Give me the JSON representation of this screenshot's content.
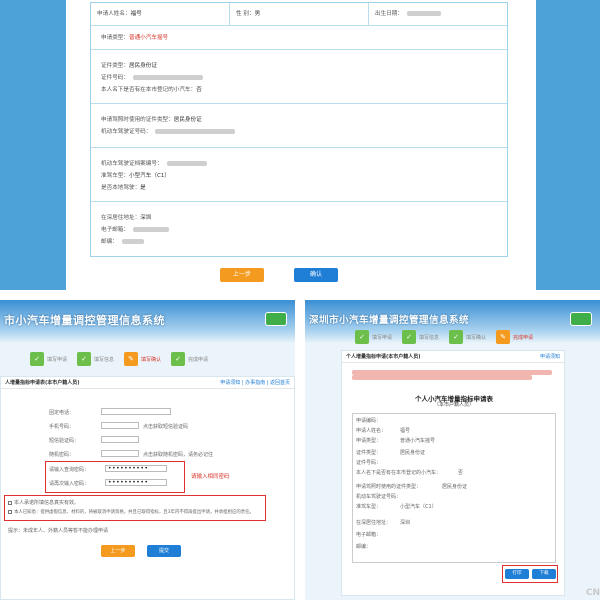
{
  "top": {
    "row1": {
      "name_label": "申请人姓名：",
      "name_value": "福号",
      "gender_label": "性 别：",
      "gender_value": "男",
      "birth_label": "出生日期："
    },
    "row2": {
      "type_label": "申请类型：",
      "type_value": "普通小汽车摇号"
    },
    "row3": {
      "id_type_label": "证件类型：",
      "id_type_value": "居民身份证",
      "id_no_label": "证件号码：",
      "owned_label": "本人名下是否有在本市登记的小汽车：",
      "owned_value": "否"
    },
    "row4": {
      "license_id_type_label": "申请驾照时使用的证件类型：",
      "license_id_type_value": "居民身份证",
      "license_no_label": "机动车驾驶证号码："
    },
    "row5": {
      "file_no_label": "机动车驾驶证档案编号：",
      "car_type_label": "准驾车型：",
      "car_type_value": "小型汽车（C1）",
      "local_label": "是否本地驾驶：",
      "local_value": "是"
    },
    "row6": {
      "address_label": "在深居住地址：",
      "address_value": "深圳",
      "email_label": "电子邮箱：",
      "postcode_label": "邮编："
    },
    "prev_button": "上一步",
    "confirm_button": "确认"
  },
  "bottom_left": {
    "banner_title": "市小汽车增量调控管理信息系统",
    "steps": [
      "填写申请",
      "填写信息",
      "填写确认",
      "完成申请"
    ],
    "section_title": "人增量指标申请表(本市户籍人员)",
    "section_links": "申请须知 | 办事指南 | 返回首页",
    "fields": [
      {
        "label": "固定电话：",
        "value": ""
      },
      {
        "label": "手机号码：",
        "value": ""
      },
      {
        "label": "短信验证码：",
        "value": ""
      },
      {
        "label": "随机密码：",
        "value": ""
      },
      {
        "label": "请输入查询密码：",
        "value": "••••••••••"
      },
      {
        "label": "请再次输入密码：",
        "value": "••••••••••"
      }
    ],
    "hint_phone": "点击获取短信验证码",
    "hint_random": "点击获取随机密码，请务必记住",
    "annotation": "请输入相同密码",
    "agree_1": "本人承诺所填信息真实有效。",
    "agree_2": "本人已知悉：提供虚假信息、材料的，将被取消申请资格，并且已取得指标，且3年内不得再提出申请，并承担相应的责任。",
    "footnote": "提示：未成年人、外籍人员等暂不能办理申请",
    "prev_button": "上一步",
    "submit_button": "提交"
  },
  "bottom_right": {
    "banner_title": "深圳市小汽车增量调控管理信息系统",
    "steps": [
      "填写申请",
      "填写信息",
      "填写确认",
      "完成申请"
    ],
    "doc_header_left": "个人增量指标申请(本市户籍人员)",
    "doc_header_right": "申请须知",
    "doc_title": "个人小汽车增量指标申请表",
    "doc_subtitle": "（本市户籍人员）",
    "fields": [
      {
        "label": "申请编码：",
        "value": ""
      },
      {
        "label": "申请人姓名：",
        "value": "福号"
      },
      {
        "label": "申请类型：",
        "value": "普通小汽车摇号"
      },
      {
        "label": "证件类型：",
        "value": "居民身份证"
      },
      {
        "label": "证件号码：",
        "value": ""
      },
      {
        "label": "本人名下是否有在本市登记的小汽车：",
        "value": "否"
      },
      {
        "label": "申请驾照时使用的证件类型：",
        "value": "居民身份证"
      },
      {
        "label": "机动车驾驶证号码：",
        "value": ""
      },
      {
        "label": "准驾车型：",
        "value": "小型汽车（C1）"
      },
      {
        "label": "在深居住地址：",
        "value": "深圳"
      },
      {
        "label": "电子邮箱：",
        "value": ""
      },
      {
        "label": "邮编：",
        "value": ""
      }
    ],
    "print_button": "打印",
    "download_button": "下载"
  },
  "watermark": "CN"
}
